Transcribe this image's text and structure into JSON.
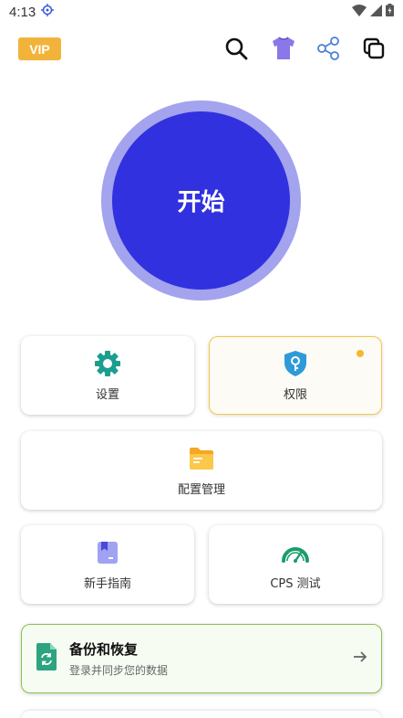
{
  "status_bar": {
    "time": "4:13",
    "icons": [
      "location-icon",
      "wifi-icon",
      "signal-icon",
      "battery-icon"
    ]
  },
  "header": {
    "vip_label": "VIP",
    "icons": [
      "search-icon",
      "shirt-icon",
      "share-icon",
      "copy-icon"
    ]
  },
  "start": {
    "label": "开始"
  },
  "cards": {
    "settings": {
      "label": "设置",
      "icon": "gear-icon"
    },
    "permissions": {
      "label": "权限",
      "icon": "shield-key-icon"
    },
    "config": {
      "label": "配置管理",
      "icon": "folder-icon"
    },
    "guide": {
      "label": "新手指南",
      "icon": "bookmark-book-icon"
    },
    "cps": {
      "label": "CPS 测试",
      "icon": "speedometer-icon"
    }
  },
  "backup": {
    "title": "备份和恢复",
    "subtitle": "登录并同步您的数据",
    "icon": "sync-file-icon"
  },
  "colors": {
    "accent": "#3131df",
    "ring": "#a3a3ee",
    "vip": "#f2b33a",
    "teal": "#1b9e8f",
    "green_border": "#8bc34a",
    "yellow_border": "#f2c94c"
  }
}
